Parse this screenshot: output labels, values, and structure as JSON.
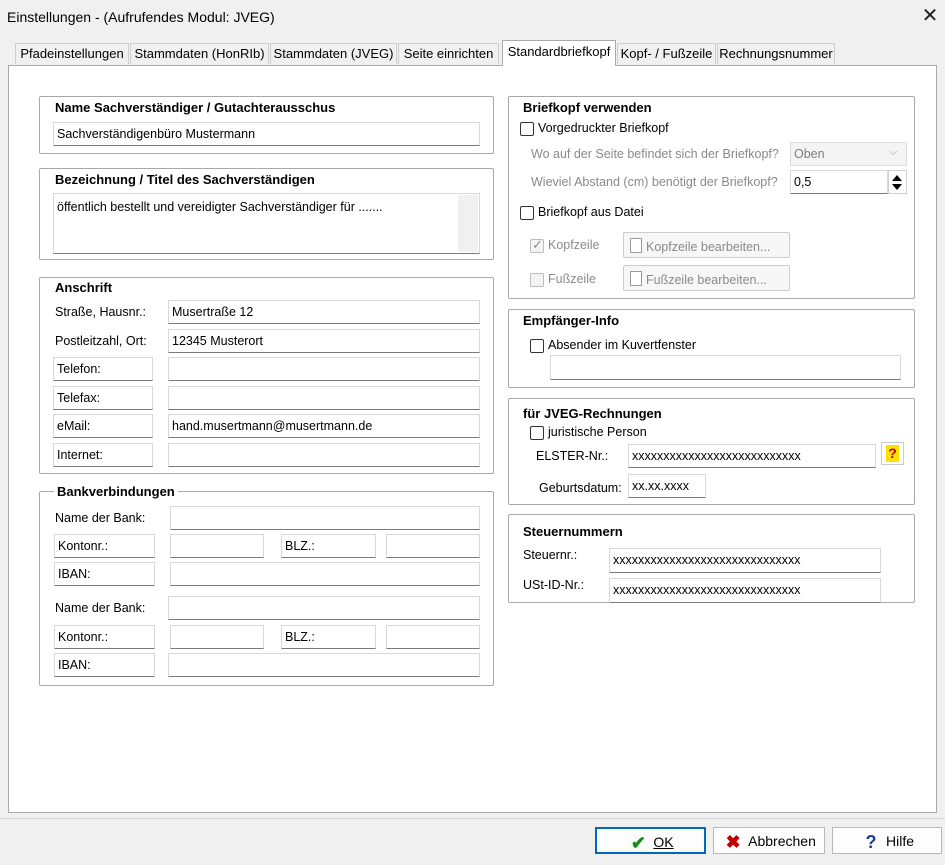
{
  "window": {
    "title": "Einstellungen  -  (Aufrufendes Modul: JVEG)"
  },
  "tabs": [
    {
      "label": "Pfadeinstellungen"
    },
    {
      "label": "Stammdaten (HonRIb)"
    },
    {
      "label": "Stammdaten (JVEG)"
    },
    {
      "label": "Seite einrichten"
    },
    {
      "label": "Standardbriefkopf"
    },
    {
      "label": "Kopf- / Fußzeile"
    },
    {
      "label": "Rechnungsnummer"
    }
  ],
  "name_group": {
    "title": "Name Sachverständiger / Gutachterausschus",
    "value": "Sachverständigenbüro Mustermann"
  },
  "title_group": {
    "title": "Bezeichnung / Titel des Sachverständigen",
    "value": "öffentlich bestellt und vereidigter Sachverständiger für ......."
  },
  "address": {
    "title": "Anschrift",
    "street_label": "Straße, Hausnr.:",
    "street": "Musertraße 12",
    "zip_label": "Postleitzahl, Ort:",
    "zip_city": "12345 Musterort",
    "phone_label": "Telefon:",
    "phone": "",
    "fax_label": "Telefax:",
    "fax": "",
    "email_label": "eMail:",
    "email": "hand.musertmann@musertmann.de",
    "internet_label": "Internet:",
    "internet": ""
  },
  "bank": {
    "title": "Bankverbindungen",
    "bank1": {
      "name_label": "Name der Bank:",
      "account_label": "Kontonr.:",
      "blz_label": "BLZ.:",
      "iban_label": "IBAN:"
    },
    "bank2": {
      "name_label": "Name der Bank:",
      "account_label": "Kontonr.:",
      "blz_label": "BLZ.:",
      "iban_label": "IBAN:"
    }
  },
  "letterhead": {
    "title": "Briefkopf verwenden",
    "preprinted_label": "Vorgedruckter Briefkopf",
    "position_question": "Wo auf der Seite befindet sich der Briefkopf?",
    "position_value": "Oben",
    "distance_question": "Wieviel Abstand (cm) benötigt der Briefkopf?",
    "distance_value": "0,5",
    "from_file_label": "Briefkopf aus Datei",
    "header_label": "Kopfzeile",
    "header_edit": "Kopfzeile bearbeiten...",
    "footer_label": "Fußzeile",
    "footer_edit": "Fußzeile bearbeiten..."
  },
  "recipient": {
    "title": "Empfänger-Info",
    "sender_label": "Absender im Kuvertfenster",
    "sender_value": ""
  },
  "jveg": {
    "title": "für JVEG-Rechnungen",
    "legal_person_label": "juristische Person",
    "elster_label": "ELSTER-Nr.:",
    "elster_value": "xxxxxxxxxxxxxxxxxxxxxxxxxxx",
    "help_icon": "?",
    "dob_label": "Geburtsdatum:",
    "dob_value": "xx.xx.xxxx"
  },
  "tax": {
    "title": "Steuernummern",
    "tax_label": "Steuernr.:",
    "tax_value": "xxxxxxxxxxxxxxxxxxxxxxxxxxxxxx",
    "vat_label": "USt-ID-Nr.:",
    "vat_value": "xxxxxxxxxxxxxxxxxxxxxxxxxxxxxx"
  },
  "buttons": {
    "ok": "OK",
    "cancel": "Abbrechen",
    "help": "Hilfe"
  },
  "colors": {
    "accent": "#0067c0",
    "ok_check": "#1a8a1a",
    "cancel_x": "#c00000",
    "help_q": "#1f3e9a"
  }
}
